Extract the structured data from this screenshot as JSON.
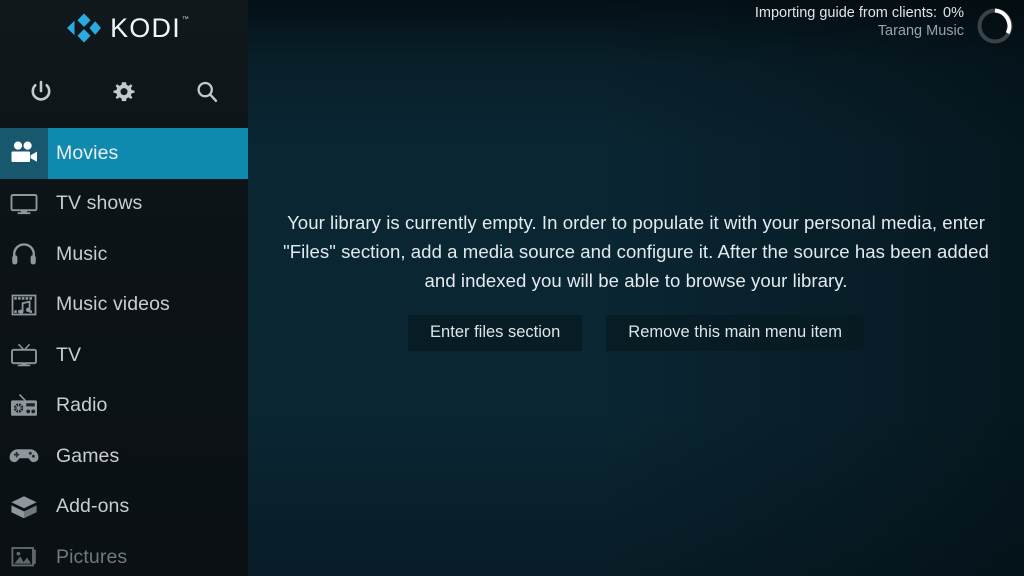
{
  "app": {
    "name": "KODI",
    "trademark": "™"
  },
  "header": {
    "logo_icon": "kodi-logo-icon",
    "actions": [
      {
        "id": "power",
        "icon": "power-icon",
        "label": "Power"
      },
      {
        "id": "settings",
        "icon": "gear-icon",
        "label": "Settings"
      },
      {
        "id": "search",
        "icon": "search-icon",
        "label": "Search"
      }
    ]
  },
  "status": {
    "message": "Importing guide from clients:",
    "percent": "0%",
    "detail": "Tarang Music",
    "spinner_icon": "loading-spinner-icon"
  },
  "sidebar": {
    "items": [
      {
        "label": "Movies",
        "icon": "movie-camera-icon",
        "selected": true,
        "dim": false
      },
      {
        "label": "TV shows",
        "icon": "monitor-icon",
        "selected": false,
        "dim": false
      },
      {
        "label": "Music",
        "icon": "headphones-icon",
        "selected": false,
        "dim": false
      },
      {
        "label": "Music videos",
        "icon": "film-music-icon",
        "selected": false,
        "dim": false
      },
      {
        "label": "TV",
        "icon": "television-icon",
        "selected": false,
        "dim": false
      },
      {
        "label": "Radio",
        "icon": "radio-icon",
        "selected": false,
        "dim": false
      },
      {
        "label": "Games",
        "icon": "gamepad-icon",
        "selected": false,
        "dim": false
      },
      {
        "label": "Add-ons",
        "icon": "box-icon",
        "selected": false,
        "dim": false
      },
      {
        "label": "Pictures",
        "icon": "picture-icon",
        "selected": false,
        "dim": true
      }
    ]
  },
  "main": {
    "empty_message": "Your library is currently empty. In order to populate it with your personal media, enter \"Files\" section, add a media source and configure it. After the source has been added and indexed you will be able to browse your library.",
    "buttons": [
      {
        "id": "enter-files",
        "label": "Enter files section"
      },
      {
        "id": "remove-menu-item",
        "label": "Remove this main menu item"
      }
    ]
  },
  "colors": {
    "accent": "#1089ae",
    "accent_dark": "#17586f",
    "sidebar_bg": "#0c1317",
    "content_bg": "#11465d",
    "logo_blue": "#29abe2"
  }
}
